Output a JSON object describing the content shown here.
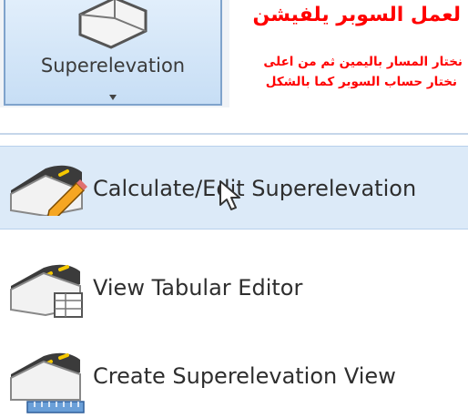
{
  "ribbon": {
    "button_label": "Superelevation",
    "button_icon": "superelevation-icon",
    "dropdown_icon": "dropdown-arrow-icon"
  },
  "note": {
    "title": "لعمل السوبر يلفيشن",
    "line1": "نختار المسار باليمين ثم من اعلى",
    "line2": "نختار حساب السوبر كما بالشكل",
    "color": "#ff0000"
  },
  "menu": {
    "items": [
      {
        "label": "Calculate/Edit Superelevation",
        "icon": "calculate-superelevation-icon",
        "selected": true
      },
      {
        "label": "View Tabular Editor",
        "icon": "tabular-editor-icon",
        "selected": false
      },
      {
        "label": "Create Superelevation View",
        "icon": "superelevation-view-icon",
        "selected": false
      }
    ]
  },
  "colors": {
    "accent": "#c7def5",
    "selected_bg": "#dceaf8",
    "road": "#3b3b3b",
    "stripe": "#f5c800"
  }
}
